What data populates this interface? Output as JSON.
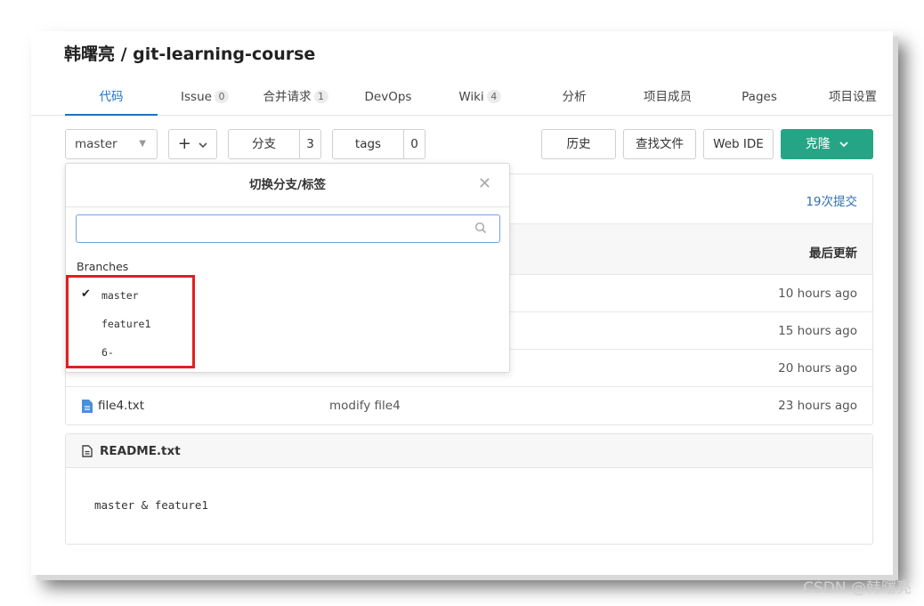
{
  "repo": {
    "title": "韩曙亮 / git-learning-course"
  },
  "tabs": [
    {
      "label": "代码",
      "count": ""
    },
    {
      "label": "Issue",
      "count": "0"
    },
    {
      "label": "合并请求",
      "count": "1"
    },
    {
      "label": "DevOps",
      "count": ""
    },
    {
      "label": "Wiki",
      "count": "4"
    },
    {
      "label": "分析",
      "count": ""
    },
    {
      "label": "项目成员",
      "count": ""
    },
    {
      "label": "Pages",
      "count": ""
    },
    {
      "label": "项目设置",
      "count": ""
    }
  ],
  "toolbar": {
    "branch": "master",
    "plus": "+",
    "branches_label": "分支",
    "branches_count": "3",
    "tags_label": "tags",
    "tags_count": "0",
    "history": "历史",
    "find_file": "查找文件",
    "web_ide": "Web IDE",
    "clone": "克隆"
  },
  "panel": {
    "commits": "19次提交",
    "last_update": "最后更新",
    "files": [
      {
        "name": "",
        "message": "",
        "time": "10 hours ago"
      },
      {
        "name": "",
        "message": "",
        "time": "15 hours ago"
      },
      {
        "name": "",
        "message": "",
        "time": "20 hours ago"
      },
      {
        "name": "file4.txt",
        "message": "modify file4",
        "time": "23 hours ago"
      }
    ]
  },
  "readme": {
    "title": "README.txt",
    "content": "master & feature1"
  },
  "dropdown": {
    "title": "切换分支/标签",
    "search_placeholder": "",
    "section": "Branches",
    "branches": [
      "master",
      "feature1",
      "6-"
    ],
    "selected": "master"
  },
  "watermark": "CSDN @韩曙亮",
  "colors": {
    "accent": "#1a73c8",
    "clone": "#25a586",
    "highlight": "#e02020"
  }
}
